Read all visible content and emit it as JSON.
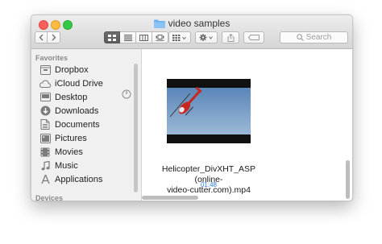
{
  "window": {
    "title": "video samples",
    "search_placeholder": "Search"
  },
  "sidebar": {
    "favorites_heading": "Favorites",
    "items": [
      {
        "label": "Dropbox",
        "icon": "dropbox-icon"
      },
      {
        "label": "iCloud Drive",
        "icon": "cloud-icon"
      },
      {
        "label": "Desktop",
        "icon": "desktop-icon"
      },
      {
        "label": "Downloads",
        "icon": "downloads-icon"
      },
      {
        "label": "Documents",
        "icon": "documents-icon"
      },
      {
        "label": "Pictures",
        "icon": "pictures-icon"
      },
      {
        "label": "Movies",
        "icon": "movies-icon"
      },
      {
        "label": "Music",
        "icon": "music-icon"
      },
      {
        "label": "Applications",
        "icon": "applications-icon"
      }
    ],
    "devices_heading": "Devices"
  },
  "content": {
    "files": [
      {
        "name": "Helicopter_DivXHT_ASP (online-video-cutter.com).mp4",
        "name_line1": "Helicopter_DivXHT_ASP (online-",
        "name_line2": "video-cutter.com).mp4",
        "duration": "01:48"
      }
    ]
  },
  "colors": {
    "accent": "#2a7ad3",
    "close": "#fc605c",
    "minimize": "#fdbc40",
    "maximize": "#34c84a"
  }
}
